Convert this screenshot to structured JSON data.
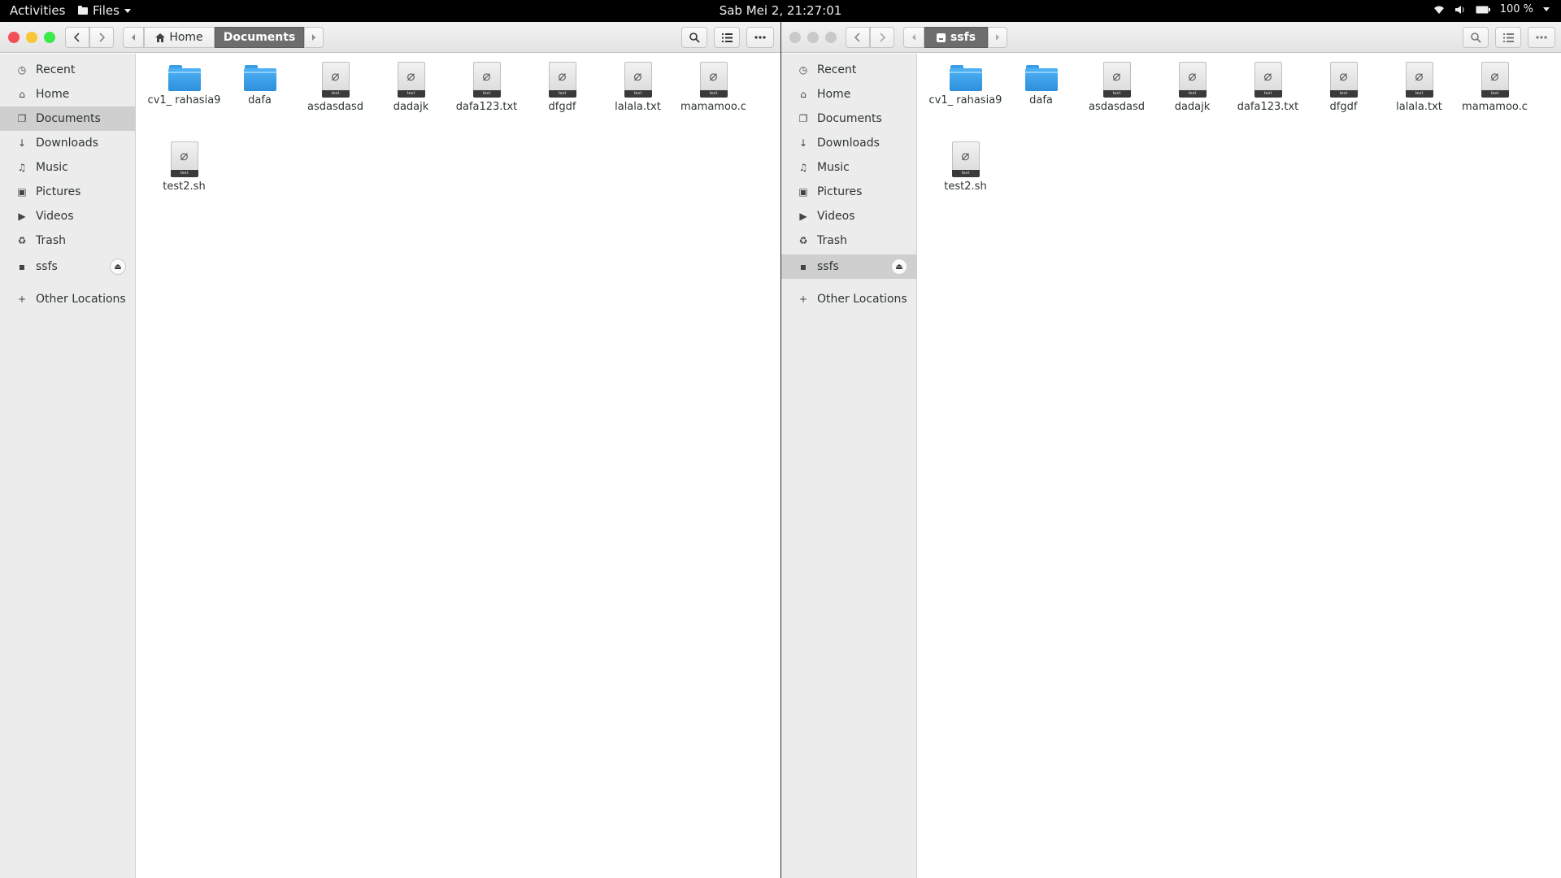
{
  "topbar": {
    "activities": "Activities",
    "app_menu": "Files",
    "clock": "Sab Mei  2, 21:27:01",
    "battery": "100 %"
  },
  "icons": {
    "recent": "clock-icon",
    "home": "home-icon",
    "documents": "documents-icon",
    "downloads": "download-icon",
    "music": "music-icon",
    "pictures": "pictures-icon",
    "videos": "video-icon",
    "trash": "trash-icon",
    "drive": "drive-icon",
    "other": "plus-icon"
  },
  "colors": {
    "folder": "#3b9ee6",
    "selected_crumb": "#6d6d6d",
    "close": "#f25056",
    "minimize": "#fac536",
    "maximize": "#39ea49"
  },
  "window1": {
    "breadcrumb": [
      "Home",
      "Documents"
    ],
    "sidebar": [
      {
        "label": "Recent"
      },
      {
        "label": "Home"
      },
      {
        "label": "Documents"
      },
      {
        "label": "Downloads"
      },
      {
        "label": "Music"
      },
      {
        "label": "Pictures"
      },
      {
        "label": "Videos"
      },
      {
        "label": "Trash"
      },
      {
        "label": "ssfs"
      },
      {
        "label": "Other Locations"
      }
    ],
    "files": [
      {
        "name": "cv1_ rahasia9",
        "type": "folder"
      },
      {
        "name": "dafa",
        "type": "folder"
      },
      {
        "name": "asdasdasd",
        "type": "text"
      },
      {
        "name": "dadajk",
        "type": "text"
      },
      {
        "name": "dafa123.txt",
        "type": "text"
      },
      {
        "name": "dfgdf",
        "type": "text"
      },
      {
        "name": "lalala.txt",
        "type": "text"
      },
      {
        "name": "mamamoo.c",
        "type": "text"
      },
      {
        "name": "test2.sh",
        "type": "text"
      }
    ]
  },
  "window2": {
    "breadcrumb": [
      "ssfs"
    ],
    "sidebar": [
      {
        "label": "Recent"
      },
      {
        "label": "Home"
      },
      {
        "label": "Documents"
      },
      {
        "label": "Downloads"
      },
      {
        "label": "Music"
      },
      {
        "label": "Pictures"
      },
      {
        "label": "Videos"
      },
      {
        "label": "Trash"
      },
      {
        "label": "ssfs"
      },
      {
        "label": "Other Locations"
      }
    ],
    "files": [
      {
        "name": "cv1_ rahasia9",
        "type": "folder"
      },
      {
        "name": "dafa",
        "type": "folder"
      },
      {
        "name": "asdasdasd",
        "type": "text"
      },
      {
        "name": "dadajk",
        "type": "text"
      },
      {
        "name": "dafa123.txt",
        "type": "text"
      },
      {
        "name": "dfgdf",
        "type": "text"
      },
      {
        "name": "lalala.txt",
        "type": "text"
      },
      {
        "name": "mamamoo.c",
        "type": "text"
      },
      {
        "name": "test2.sh",
        "type": "text"
      }
    ],
    "doc_band_text": "text"
  }
}
